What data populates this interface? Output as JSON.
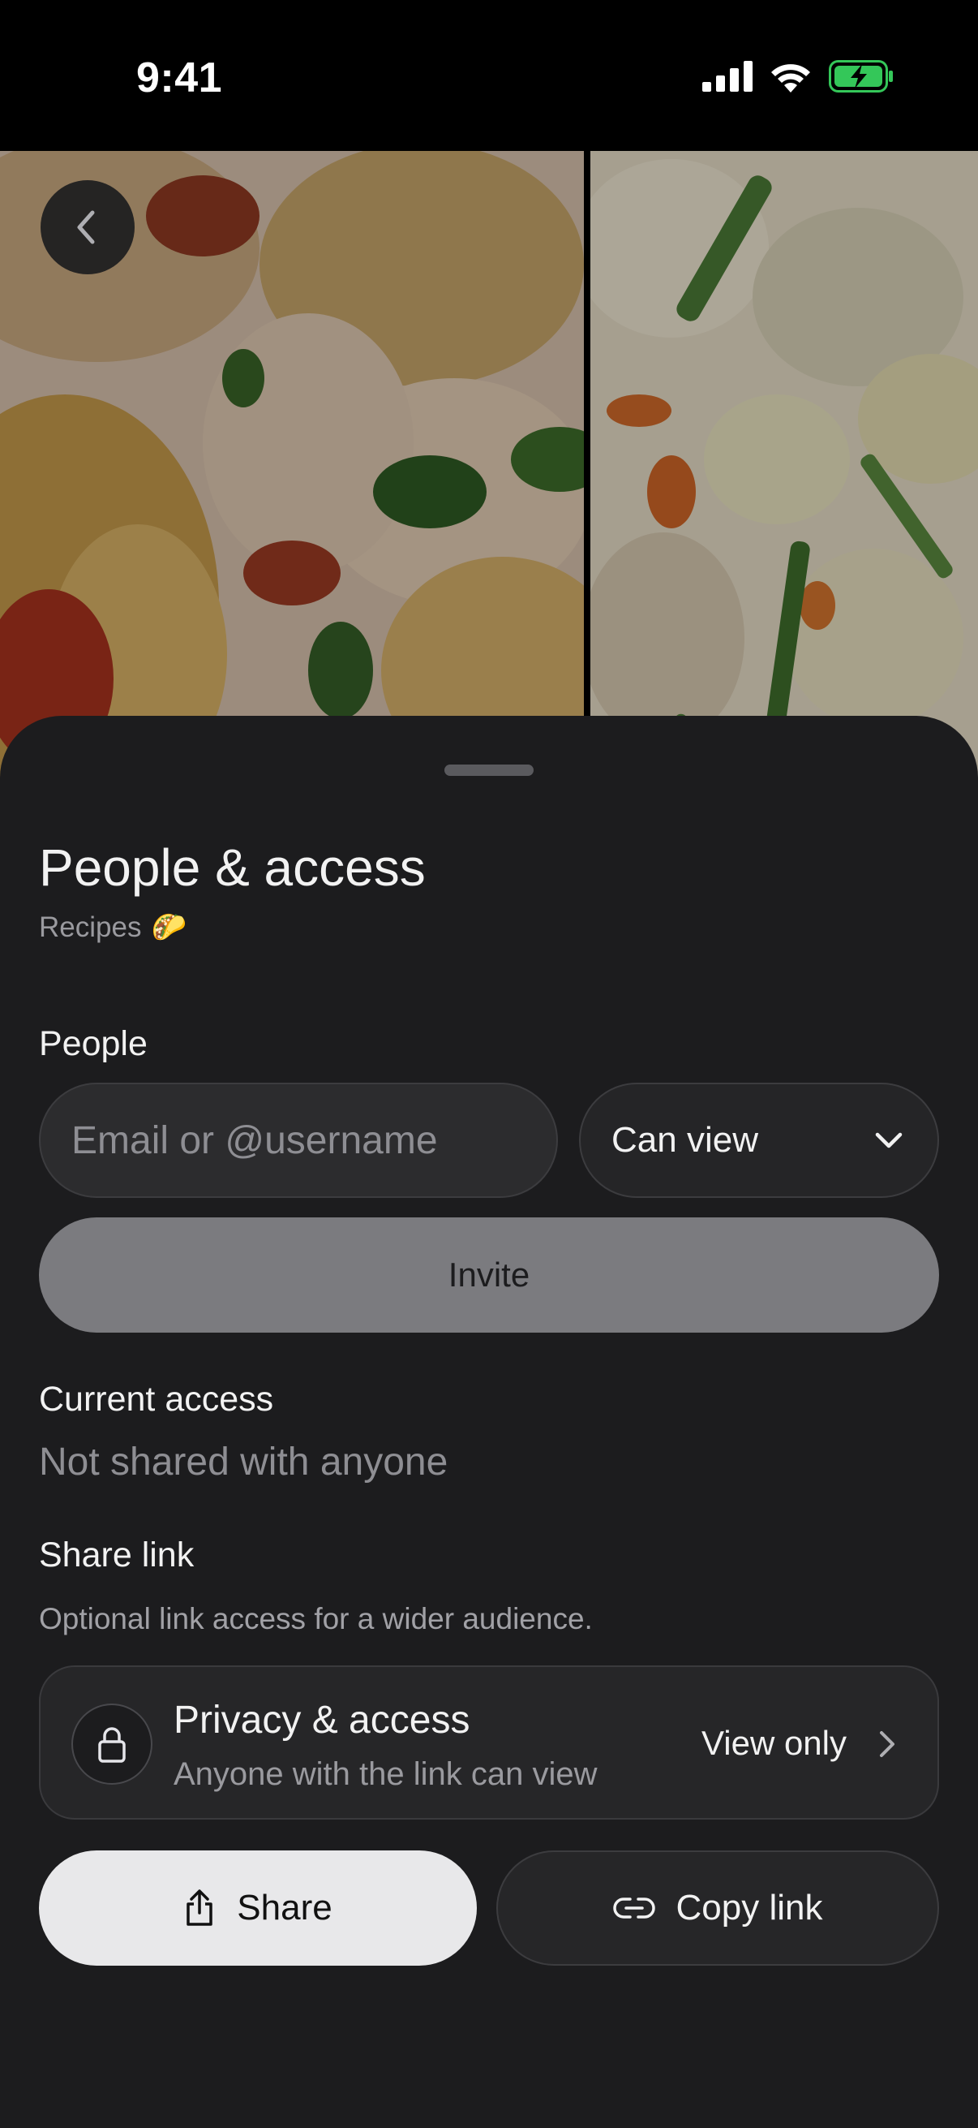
{
  "status_bar": {
    "time": "9:41"
  },
  "sheet": {
    "title": "People & access",
    "subtitle": "Recipes",
    "subtitle_emoji": "🌮",
    "people": {
      "label": "People",
      "email_placeholder": "Email or @username",
      "role_value": "Can view",
      "invite_label": "Invite"
    },
    "current_access": {
      "label": "Current access",
      "value": "Not shared with anyone"
    },
    "share_link": {
      "label": "Share link",
      "description": "Optional link access for a wider audience.",
      "privacy_title": "Privacy & access",
      "privacy_description": "Anyone with the link can view",
      "privacy_value": "View only"
    },
    "actions": {
      "share_label": "Share",
      "copy_link_label": "Copy link"
    }
  },
  "colors": {
    "sheet_background": "#1c1c1e",
    "invite_button": "#7b7b7f",
    "share_button": "#e8e8ea",
    "battery_fill": "#34c759"
  },
  "icons": [
    "signal-icon",
    "wifi-icon",
    "battery-charging-icon",
    "chevron-left-icon",
    "chevron-down-icon",
    "lock-icon",
    "chevron-right-icon",
    "share-icon",
    "link-icon"
  ]
}
